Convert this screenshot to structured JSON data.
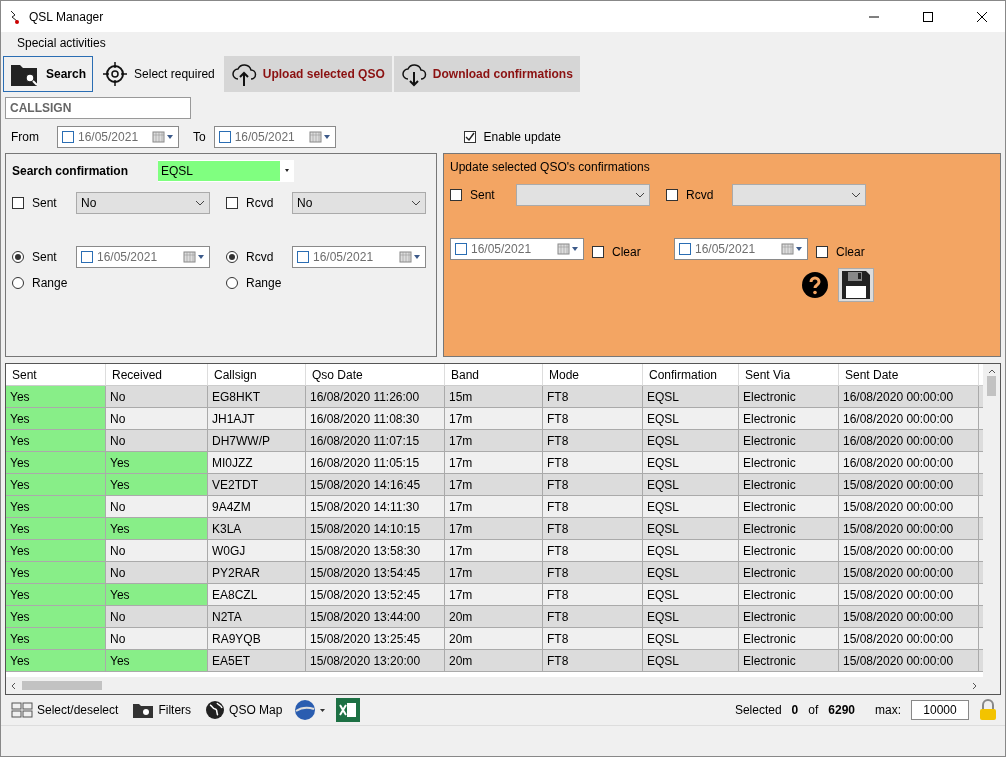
{
  "window": {
    "title": "QSL Manager"
  },
  "menu": [
    {
      "label": "Special activities"
    }
  ],
  "toolbar": [
    {
      "label": "Search",
      "kind": "tab",
      "selected": true
    },
    {
      "label": "Select required",
      "kind": "tab",
      "selected": false
    },
    {
      "label": "Upload selected QSO",
      "kind": "action",
      "selected": false
    },
    {
      "label": "Download confirmations",
      "kind": "action",
      "selected": false
    }
  ],
  "callsign": {
    "placeholder": "CALLSIGN"
  },
  "date_range": {
    "from_label": "From",
    "from": {
      "checked": false,
      "value": "16/05/2021"
    },
    "to_label": "To",
    "to": {
      "checked": false,
      "value": "16/05/2021"
    }
  },
  "enable_update": {
    "label": "Enable update",
    "checked": true
  },
  "search_panel": {
    "title": "Search confirmation",
    "confirmation": "EQSL",
    "sent": {
      "label": "Sent",
      "checked": false,
      "value": "No"
    },
    "rcvd": {
      "label": "Rcvd",
      "checked": false,
      "value": "No"
    },
    "sent_options": [
      {
        "label": "Sent",
        "selected": true
      },
      {
        "label": "Range",
        "selected": false
      }
    ],
    "sent_date": {
      "checked": false,
      "value": "16/05/2021"
    },
    "rcvd_options": [
      {
        "label": "Rcvd",
        "selected": true
      },
      {
        "label": "Range",
        "selected": false
      }
    ],
    "rcvd_date": {
      "checked": false,
      "value": "16/05/2021"
    }
  },
  "update_panel": {
    "title": "Update selected QSO's confirmations",
    "sent": {
      "label": "Sent",
      "checked": false
    },
    "rcvd": {
      "label": "Rcvd",
      "checked": false
    },
    "sent_date": {
      "checked": false,
      "value": "16/05/2021"
    },
    "sent_clear": {
      "label": "Clear",
      "checked": false
    },
    "rcvd_date": {
      "checked": false,
      "value": "16/05/2021"
    },
    "rcvd_clear": {
      "label": "Clear",
      "checked": false
    }
  },
  "table": {
    "columns": [
      "Sent",
      "Received",
      "Callsign",
      "Qso Date",
      "Band",
      "Mode",
      "Confirmation",
      "Sent Via",
      "Sent Date"
    ],
    "rows": [
      {
        "sent": "Yes",
        "sent_confirmed": true,
        "received": "No",
        "received_confirmed": false,
        "callsign": "EG8HKT",
        "qso_date": "16/08/2020 11:26:00",
        "band": "15m",
        "mode": "FT8",
        "confirmation": "EQSL",
        "sent_via": "Electronic",
        "sent_date": "16/08/2020 00:00:00"
      },
      {
        "sent": "Yes",
        "sent_confirmed": true,
        "received": "No",
        "received_confirmed": false,
        "callsign": "JH1AJT",
        "qso_date": "16/08/2020 11:08:30",
        "band": "17m",
        "mode": "FT8",
        "confirmation": "EQSL",
        "sent_via": "Electronic",
        "sent_date": "16/08/2020 00:00:00"
      },
      {
        "sent": "Yes",
        "sent_confirmed": true,
        "received": "No",
        "received_confirmed": false,
        "callsign": "DH7WW/P",
        "qso_date": "16/08/2020 11:07:15",
        "band": "17m",
        "mode": "FT8",
        "confirmation": "EQSL",
        "sent_via": "Electronic",
        "sent_date": "16/08/2020 00:00:00"
      },
      {
        "sent": "Yes",
        "sent_confirmed": true,
        "received": "Yes",
        "received_confirmed": true,
        "callsign": "MI0JZZ",
        "qso_date": "16/08/2020 11:05:15",
        "band": "17m",
        "mode": "FT8",
        "confirmation": "EQSL",
        "sent_via": "Electronic",
        "sent_date": "16/08/2020 00:00:00"
      },
      {
        "sent": "Yes",
        "sent_confirmed": true,
        "received": "Yes",
        "received_confirmed": true,
        "callsign": "VE2TDT",
        "qso_date": "15/08/2020 14:16:45",
        "band": "17m",
        "mode": "FT8",
        "confirmation": "EQSL",
        "sent_via": "Electronic",
        "sent_date": "15/08/2020 00:00:00"
      },
      {
        "sent": "Yes",
        "sent_confirmed": true,
        "received": "No",
        "received_confirmed": false,
        "callsign": "9A4ZM",
        "qso_date": "15/08/2020 14:11:30",
        "band": "17m",
        "mode": "FT8",
        "confirmation": "EQSL",
        "sent_via": "Electronic",
        "sent_date": "15/08/2020 00:00:00"
      },
      {
        "sent": "Yes",
        "sent_confirmed": true,
        "received": "Yes",
        "received_confirmed": true,
        "callsign": "K3LA",
        "qso_date": "15/08/2020 14:10:15",
        "band": "17m",
        "mode": "FT8",
        "confirmation": "EQSL",
        "sent_via": "Electronic",
        "sent_date": "15/08/2020 00:00:00"
      },
      {
        "sent": "Yes",
        "sent_confirmed": true,
        "received": "No",
        "received_confirmed": false,
        "callsign": "W0GJ",
        "qso_date": "15/08/2020 13:58:30",
        "band": "17m",
        "mode": "FT8",
        "confirmation": "EQSL",
        "sent_via": "Electronic",
        "sent_date": "15/08/2020 00:00:00"
      },
      {
        "sent": "Yes",
        "sent_confirmed": true,
        "received": "No",
        "received_confirmed": false,
        "callsign": "PY2RAR",
        "qso_date": "15/08/2020 13:54:45",
        "band": "17m",
        "mode": "FT8",
        "confirmation": "EQSL",
        "sent_via": "Electronic",
        "sent_date": "15/08/2020 00:00:00"
      },
      {
        "sent": "Yes",
        "sent_confirmed": true,
        "received": "Yes",
        "received_confirmed": true,
        "callsign": "EA8CZL",
        "qso_date": "15/08/2020 13:52:45",
        "band": "17m",
        "mode": "FT8",
        "confirmation": "EQSL",
        "sent_via": "Electronic",
        "sent_date": "15/08/2020 00:00:00"
      },
      {
        "sent": "Yes",
        "sent_confirmed": true,
        "received": "No",
        "received_confirmed": false,
        "callsign": "N2TA",
        "qso_date": "15/08/2020 13:44:00",
        "band": "20m",
        "mode": "FT8",
        "confirmation": "EQSL",
        "sent_via": "Electronic",
        "sent_date": "15/08/2020 00:00:00"
      },
      {
        "sent": "Yes",
        "sent_confirmed": true,
        "received": "No",
        "received_confirmed": false,
        "callsign": "RA9YQB",
        "qso_date": "15/08/2020 13:25:45",
        "band": "20m",
        "mode": "FT8",
        "confirmation": "EQSL",
        "sent_via": "Electronic",
        "sent_date": "15/08/2020 00:00:00"
      },
      {
        "sent": "Yes",
        "sent_confirmed": true,
        "received": "Yes",
        "received_confirmed": true,
        "callsign": "EA5ET",
        "qso_date": "15/08/2020 13:20:00",
        "band": "20m",
        "mode": "FT8",
        "confirmation": "EQSL",
        "sent_via": "Electronic",
        "sent_date": "15/08/2020 00:00:00"
      }
    ]
  },
  "bottom_toolbar": {
    "items": [
      {
        "label": "Select/deselect"
      },
      {
        "label": "Filters"
      },
      {
        "label": "QSO Map"
      }
    ],
    "selected_label": "Selected",
    "selected_count": "0",
    "of_label": "of",
    "total": "6290",
    "max_label": "max:",
    "max_value": "10000"
  }
}
